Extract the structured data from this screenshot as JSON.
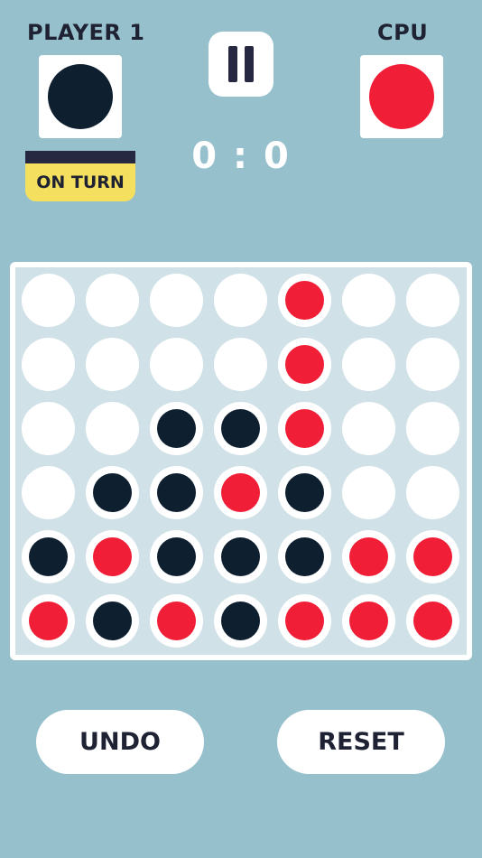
{
  "colors": {
    "background": "#97c0cd",
    "player": "#0e1f30",
    "cpu": "#f01e37",
    "badge_bar": "#262841",
    "badge_fill": "#f4df5e",
    "text_dark": "#1e2233",
    "board_bg": "#d0e1e8",
    "empty_cell": "#ffffff"
  },
  "header": {
    "player1": {
      "name": "PLAYER 1",
      "token": "player"
    },
    "cpu": {
      "name": "CPU",
      "token": "cpu"
    },
    "turn_label": "ON TURN",
    "score": {
      "player1": "0",
      "separator": ":",
      "cpu": "0"
    },
    "pause_icon": "pause-icon"
  },
  "board": {
    "columns": 7,
    "rows": 6,
    "cells": [
      [
        "",
        "",
        "",
        "",
        "cpu",
        "",
        ""
      ],
      [
        "",
        "",
        "",
        "",
        "cpu",
        "",
        ""
      ],
      [
        "",
        "",
        "player",
        "player",
        "cpu",
        "",
        ""
      ],
      [
        "",
        "player",
        "player",
        "cpu",
        "player",
        "",
        ""
      ],
      [
        "player",
        "cpu",
        "player",
        "player",
        "player",
        "cpu",
        "cpu"
      ],
      [
        "cpu",
        "player",
        "cpu",
        "player",
        "cpu",
        "cpu",
        "cpu"
      ]
    ]
  },
  "controls": {
    "undo_label": "UNDO",
    "reset_label": "RESET"
  }
}
